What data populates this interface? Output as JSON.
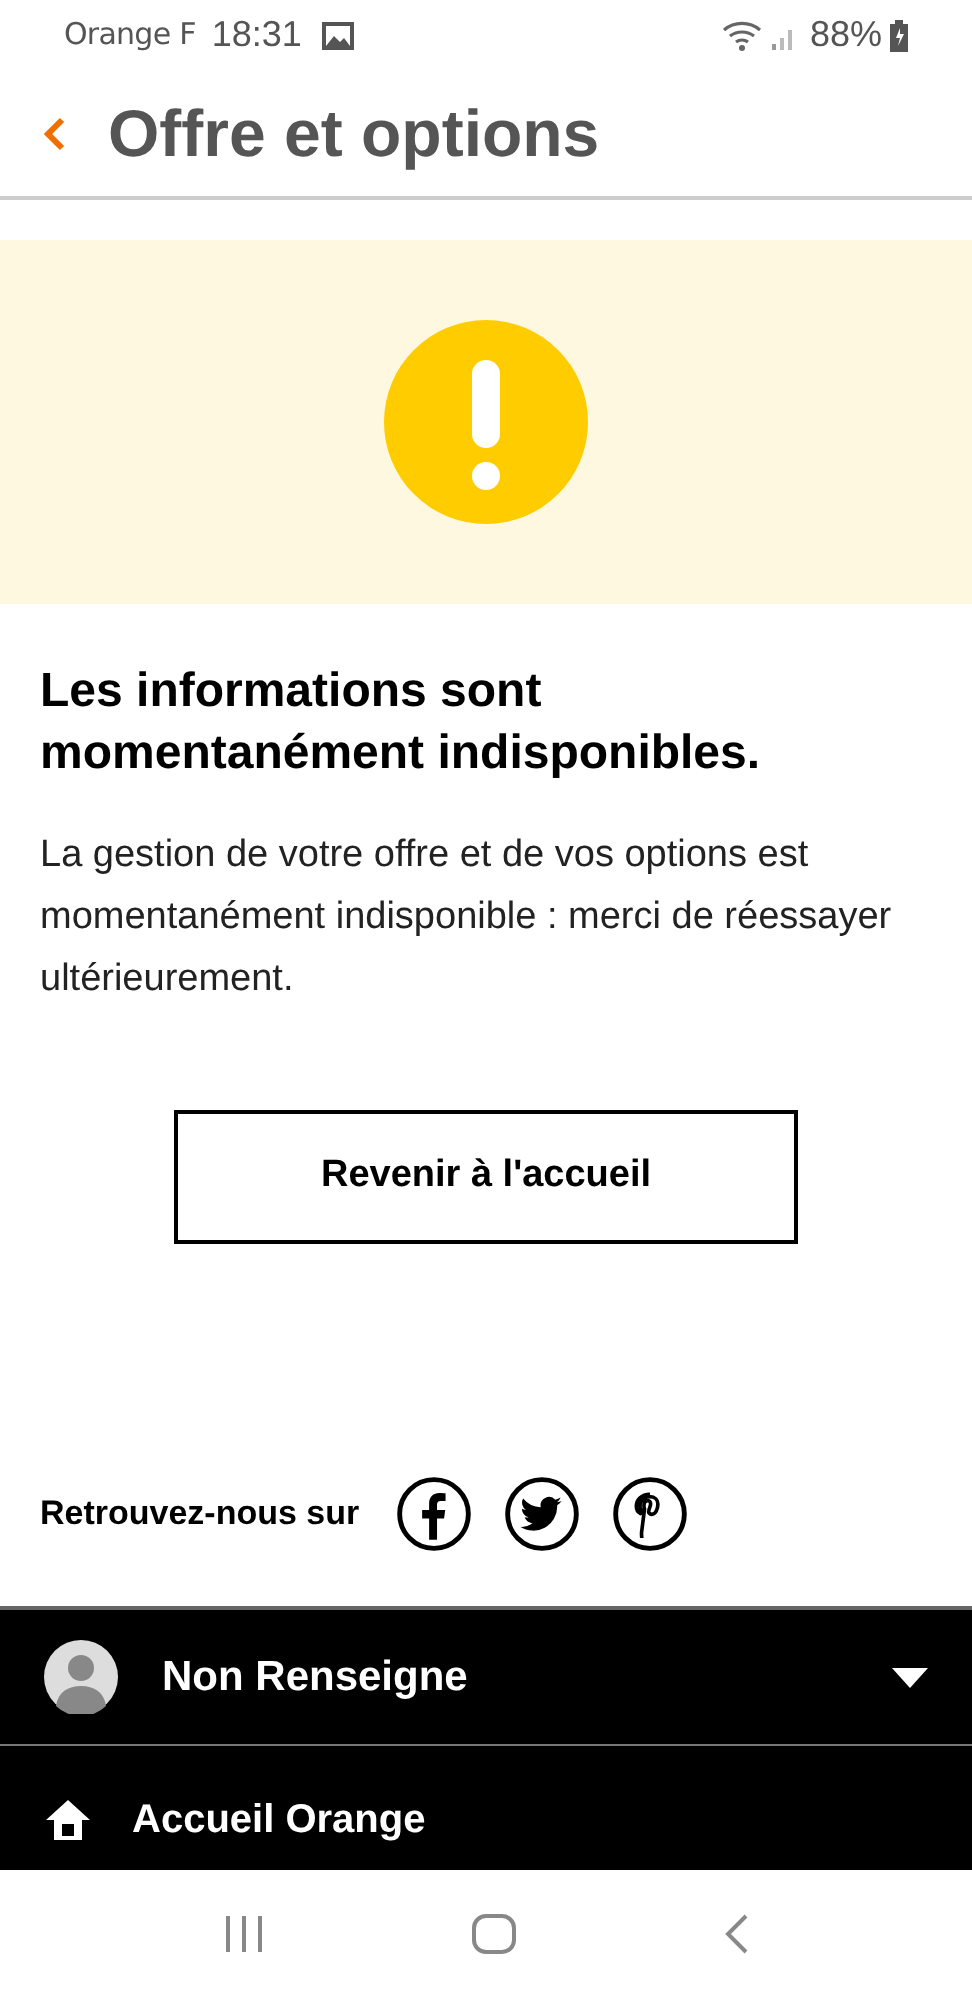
{
  "status_bar": {
    "carrier": "Orange F",
    "time": "18:31",
    "battery": "88%"
  },
  "header": {
    "title": "Offre et options"
  },
  "message": {
    "heading": "Les informations sont momentanément indisponibles.",
    "body": "La gestion de votre offre et de vos options est momentanément indisponible : merci de réessayer ultérieurement."
  },
  "button": {
    "label": "Revenir à l'accueil"
  },
  "social": {
    "label": "Retrouvez-nous sur",
    "networks": [
      {
        "kind": "facebook"
      },
      {
        "kind": "twitter"
      },
      {
        "kind": "pinterest"
      }
    ]
  },
  "menu": {
    "user": {
      "name": "Non Renseigne",
      "expanded": false
    },
    "items": [
      {
        "label": "Accueil Orange"
      }
    ]
  }
}
